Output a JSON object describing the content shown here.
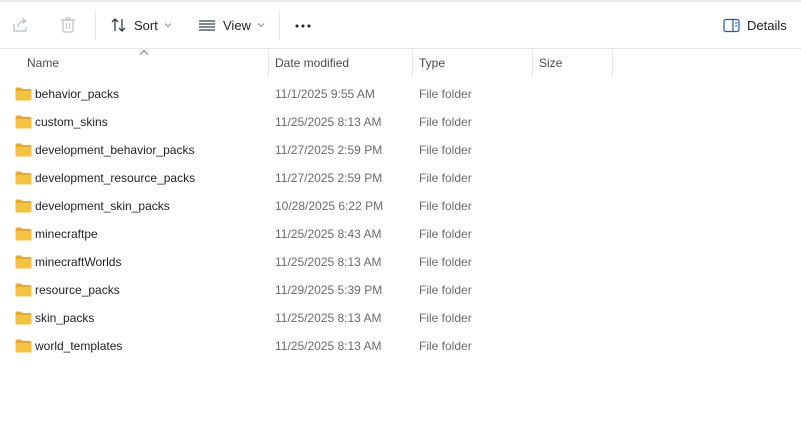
{
  "toolbar": {
    "share_icon": "share-icon",
    "delete_icon": "delete-icon",
    "sort_label": "Sort",
    "view_label": "View",
    "more_icon": "more-options-icon",
    "details_label": "Details"
  },
  "columns": {
    "name": "Name",
    "date": "Date modified",
    "type": "Type",
    "size": "Size"
  },
  "rows": [
    {
      "name": "behavior_packs",
      "date": "11/1/2025 9:55 AM",
      "type": "File folder",
      "size": ""
    },
    {
      "name": "custom_skins",
      "date": "11/25/2025 8:13 AM",
      "type": "File folder",
      "size": ""
    },
    {
      "name": "development_behavior_packs",
      "date": "11/27/2025 2:59 PM",
      "type": "File folder",
      "size": ""
    },
    {
      "name": "development_resource_packs",
      "date": "11/27/2025 2:59 PM",
      "type": "File folder",
      "size": ""
    },
    {
      "name": "development_skin_packs",
      "date": "10/28/2025 6:22 PM",
      "type": "File folder",
      "size": ""
    },
    {
      "name": "minecraftpe",
      "date": "11/25/2025 8:43 AM",
      "type": "File folder",
      "size": ""
    },
    {
      "name": "minecraftWorlds",
      "date": "11/25/2025 8:13 AM",
      "type": "File folder",
      "size": ""
    },
    {
      "name": "resource_packs",
      "date": "11/29/2025 5:39 PM",
      "type": "File folder",
      "size": ""
    },
    {
      "name": "skin_packs",
      "date": "11/25/2025 8:13 AM",
      "type": "File folder",
      "size": ""
    },
    {
      "name": "world_templates",
      "date": "11/25/2025 8:13 AM",
      "type": "File folder",
      "size": ""
    }
  ],
  "colors": {
    "folder_body": "#f5c342",
    "folder_tab": "#e6a92a",
    "accent": "#0067c0"
  }
}
